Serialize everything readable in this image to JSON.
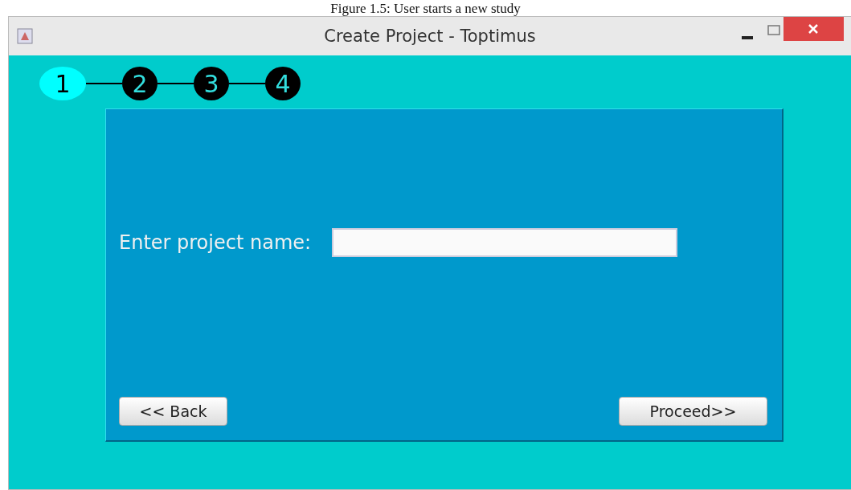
{
  "caption": "Figure 1.5: User starts a new study",
  "window": {
    "title": "Create Project - Toptimus"
  },
  "steps": [
    {
      "label": "1",
      "selected": true
    },
    {
      "label": "2",
      "selected": false
    },
    {
      "label": "3",
      "selected": false
    },
    {
      "label": "4",
      "selected": false
    }
  ],
  "form": {
    "label": "Enter project name:"
  },
  "buttons": {
    "back": "<< Back",
    "proceed": "Proceed>>"
  }
}
